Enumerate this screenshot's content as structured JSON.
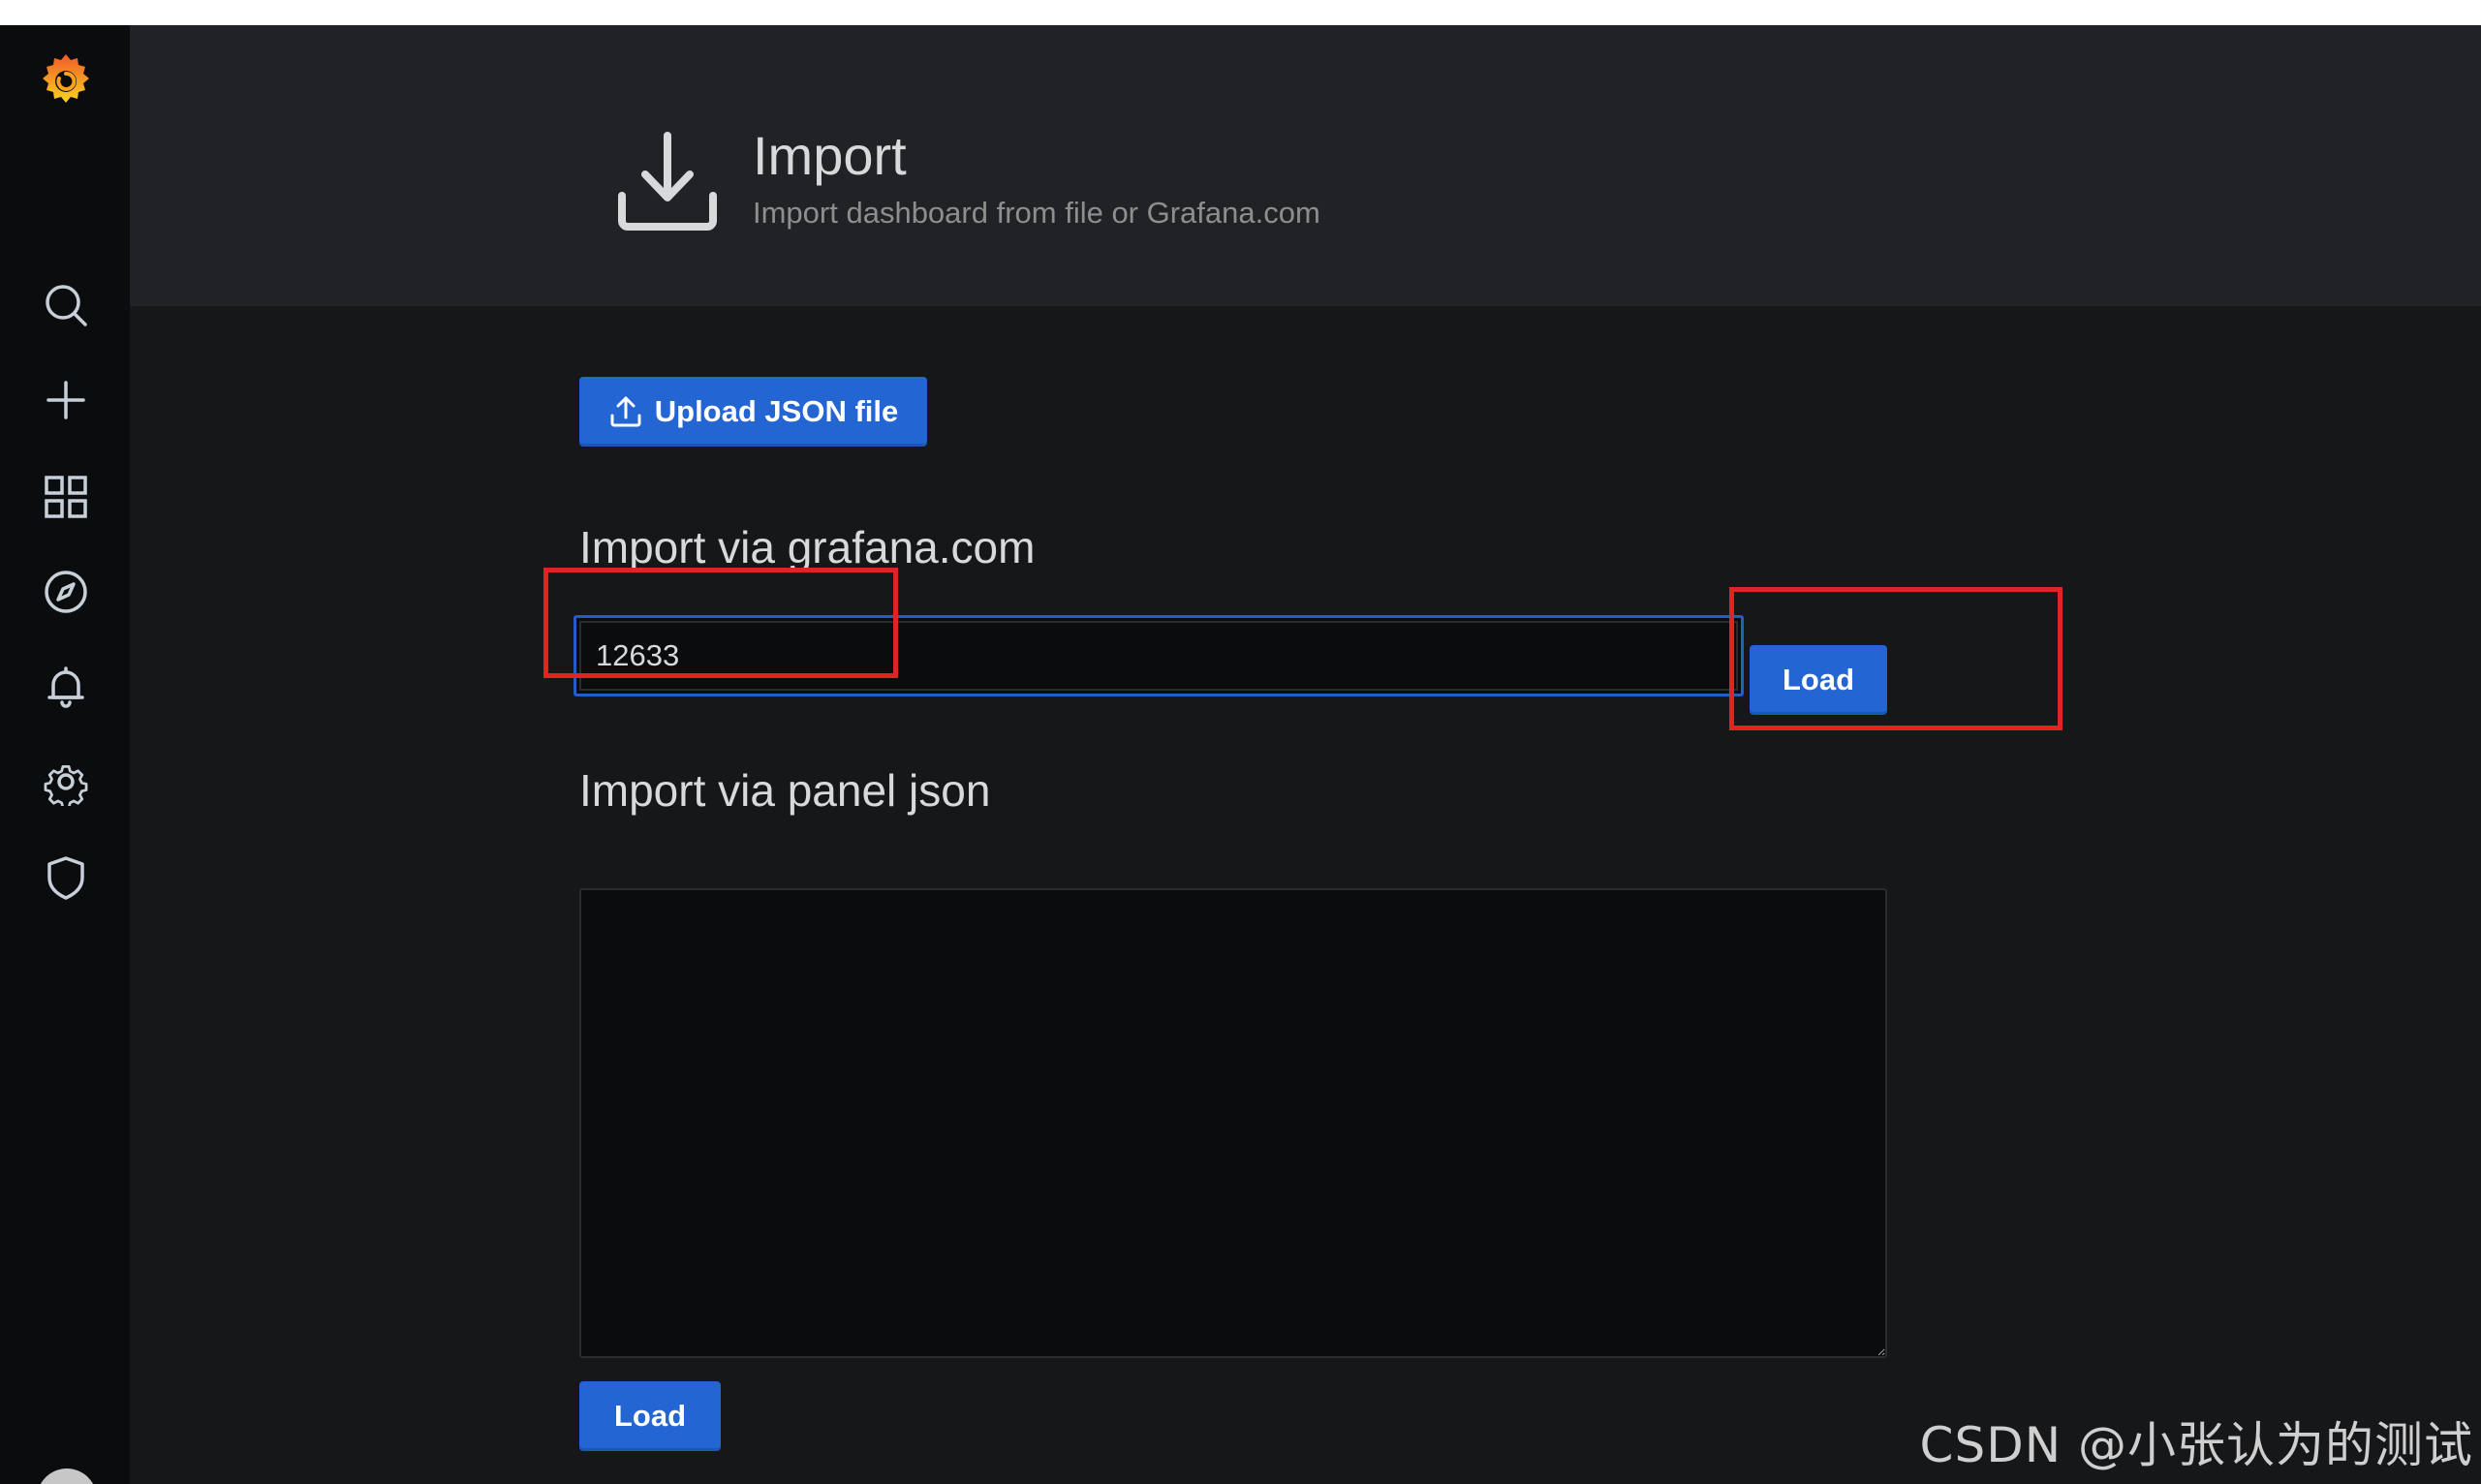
{
  "header": {
    "title": "Import",
    "subtitle": "Import dashboard from file or Grafana.com"
  },
  "sidebar": {
    "items": [
      {
        "name": "search",
        "icon": "search-icon"
      },
      {
        "name": "create",
        "icon": "plus-icon"
      },
      {
        "name": "dashboards",
        "icon": "dashboards-grid-icon"
      },
      {
        "name": "explore",
        "icon": "compass-icon"
      },
      {
        "name": "alerting",
        "icon": "bell-icon"
      },
      {
        "name": "configuration",
        "icon": "gear-icon"
      },
      {
        "name": "server-admin",
        "icon": "shield-icon"
      }
    ]
  },
  "upload": {
    "label": "Upload JSON file"
  },
  "grafana_com": {
    "title": "Import via grafana.com",
    "value": "12633",
    "load_label": "Load"
  },
  "panel_json": {
    "title": "Import via panel json",
    "value": "",
    "load_label": "Load"
  },
  "watermark": "CSDN @小张认为的测试",
  "colors": {
    "primary": "#2365d3",
    "annotation": "#e02424",
    "background": "#161719",
    "sidebar": "#0b0c0e",
    "header": "#202226"
  }
}
